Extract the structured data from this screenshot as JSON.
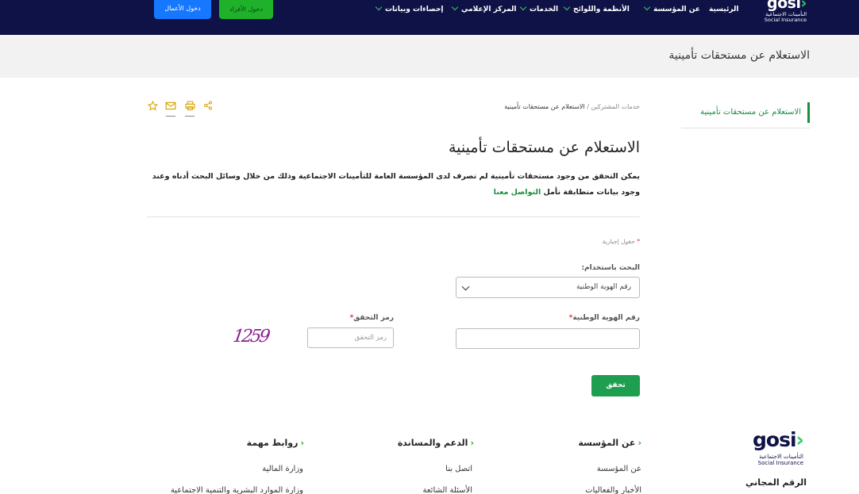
{
  "header": {
    "logo": {
      "wordmark": "gosi",
      "arabic": "التأمينات الاجتماعية",
      "english": "Social Insurance"
    },
    "nav": [
      {
        "label": "الرئيسية"
      },
      {
        "label": "عن المؤسسة"
      },
      {
        "label": "الأنظمة واللوائح"
      },
      {
        "label": "الخدمات"
      },
      {
        "label": "المركز الإعلامي"
      },
      {
        "label": "إحصاءات وبيانات"
      }
    ],
    "individuals_login": "دخول الأفراد",
    "business_login": "دخول الأعمال"
  },
  "band": {
    "title": "الاستعلام عن مستحقات تأمينية"
  },
  "sidebar": {
    "active_item": "الاستعلام عن مستحقات تأمينية"
  },
  "breadcrumb": {
    "parent": "خدمات المشتركين",
    "separator": "/",
    "current": "الاستعلام عن مستحقات تأمينية"
  },
  "share_icons": [
    "star-icon",
    "mail-icon",
    "print-icon",
    "share-icon"
  ],
  "main": {
    "title": "الاستعلام عن مستحقات تأمينية",
    "description": "يمكن التحقق من وجود مستحقات تأمينية لم تصرف لدى المؤسسة العامة للتأمينات الاجتماعية وذلك من خلال وسائل البحث أدناه وعند وجود بيانات متطابقة نأمل",
    "contact_link": "التواصل معنا"
  },
  "form": {
    "required_note": "حقول إجبارية",
    "required_star": "*",
    "search_by_label": "البحث باستخدام:",
    "search_by_value": "رقم الهوية الوطنية",
    "id_label": "رقم الهوية الوطنية",
    "id_value": "",
    "captcha_label": "رمز التحقق",
    "captcha_placeholder": "رمز التحقق",
    "captcha_text": "1259",
    "verify_button": "تحقق"
  },
  "footer": {
    "logo": {
      "wordmark": "gosi",
      "arabic": "التأمينات الاجتماعية",
      "english": "Social Insurance"
    },
    "free_number_label": "الرقم المجاني",
    "columns": [
      {
        "heading": "عن المؤسسة",
        "links": [
          "عن المؤسسة",
          "الأخبار والفعاليات"
        ]
      },
      {
        "heading": "الدعم والمساندة",
        "links": [
          "اتصل بنا",
          "الأسئلة الشائعة"
        ]
      },
      {
        "heading": "روابط مهمة",
        "links": [
          "وزارة المالية",
          "وزارة الموارد البشرية والتنمية الاجتماعية"
        ]
      }
    ]
  },
  "colors": {
    "navy": "#0f1247",
    "green": "#1e9e4f",
    "blue": "#1677ff",
    "accent_text": "#1a8e3b",
    "icon_gold": "#d8a100"
  }
}
